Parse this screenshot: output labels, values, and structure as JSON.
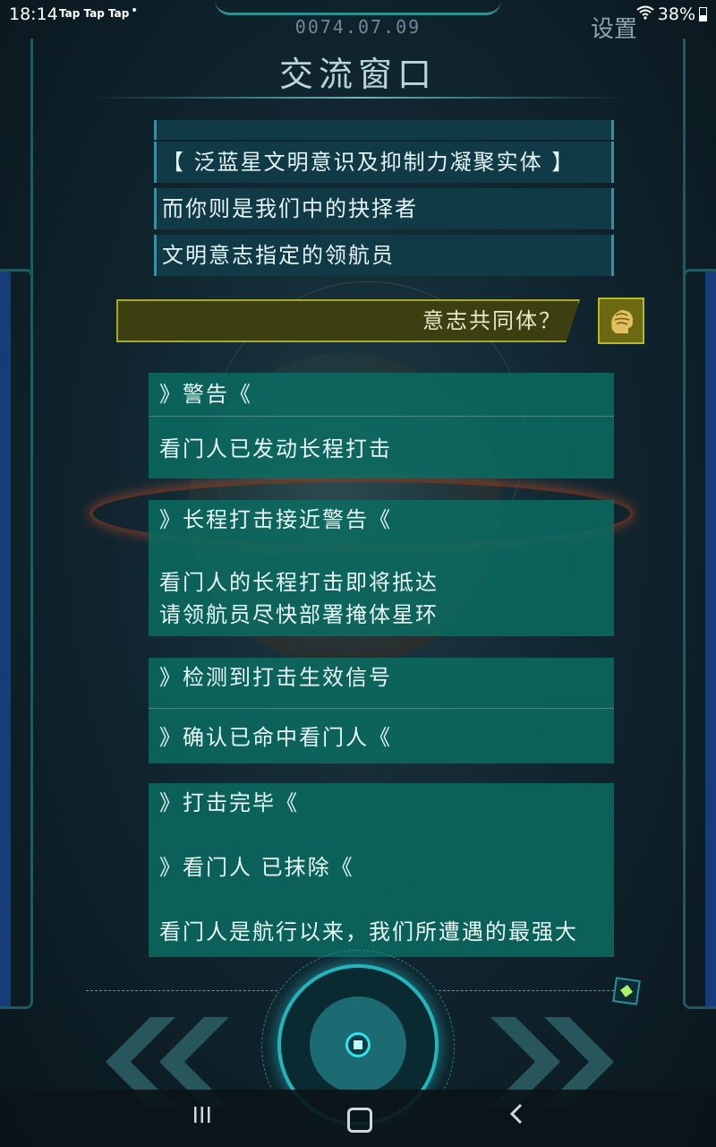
{
  "status": {
    "time": "18:14",
    "apps": "Tap Tap Tap",
    "dot": "•",
    "battery": "38%"
  },
  "header": {
    "date": "0074.07.09",
    "title": "交流窗口",
    "settings_label": "设置"
  },
  "dialog": {
    "lines": [
      "【 泛蓝星文明意识及抑制力凝聚实体 】",
      "而你则是我们中的抉择者",
      "文明意志指定的领航员"
    ]
  },
  "reply": {
    "text": "意志共同体？"
  },
  "messages": [
    {
      "title": "》警告《",
      "body": [
        "看门人已发动长程打击"
      ]
    },
    {
      "title": "》长程打击接近警告《",
      "body": [
        "看门人的长程打击即将抵达",
        "请领航员尽快部署掩体星环"
      ]
    },
    {
      "title": "》检测到打击生效信号",
      "body": [
        "》确认已命中看门人《"
      ]
    },
    {
      "title": "》打击完毕《",
      "body": [
        "》看门人 已抹除《",
        "看门人是航行以来，我们所遭遇的最强大"
      ]
    }
  ],
  "icons": {
    "settings": "gear-text",
    "avatar": "brain-head-icon",
    "center": "play-core-icon",
    "left": "double-chevron-left-icon",
    "right": "double-chevron-right-icon"
  },
  "colors": {
    "message_card": "#0a6c62",
    "dialog_box": "#0f3a46",
    "reply_box": "#3e3f10",
    "accent": "#23b5bd"
  }
}
